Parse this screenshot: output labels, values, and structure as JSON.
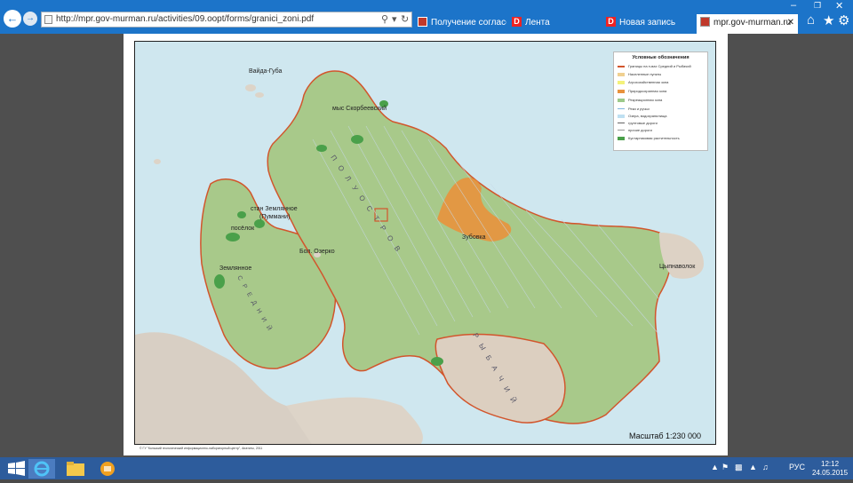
{
  "browser": {
    "url": "http://mpr.gov-murman.ru/activities/09.oopt/forms/granici_zoni.pdf",
    "tabs": [
      {
        "label": "Получение согласован..."
      },
      {
        "label": "Лента"
      },
      {
        "label": "Новая запись"
      },
      {
        "label": "mpr.gov-murman.ru"
      }
    ],
    "back_icon": "arrow-left-icon",
    "forward_icon": "arrow-right-icon",
    "home_icon": "home-icon",
    "star_icon": "star-icon",
    "settings_icon": "gear-icon",
    "accent": "#1c74c9"
  },
  "map": {
    "places": {
      "vaida_guba": "Вайда-Губа",
      "mys_skorbeevskiy": "мыс Скорбеевский",
      "stan_zemlyanoe": "стан Землянное",
      "pummanki": "(Пуммани)",
      "posyolok": "посёлок",
      "zemlyanoe": "Землянное",
      "bol_ozerko": "Бол. Озерко",
      "zubovka": "Зубовка",
      "tsypnavolok": "Цыпнаволок"
    },
    "peninsula_sredniy": "П О Л У О С Т Р О В",
    "peninsula_rybachiy": "Р Ы Б А Ч И Й",
    "peninsula_sredniy_small": "С Р Е Д Н И Й",
    "scale": "Масштаб 1:230 000",
    "copyright": "© ГУ \"Кольский геологический информационно-лабораторный центр\", Апатиты, 2011",
    "colors": {
      "sea": "#cfe7ef",
      "land": "#a8c98a",
      "reserve": "#e8923c",
      "border": "#d2552c",
      "mountains": "#d8cfc4"
    }
  },
  "legend": {
    "title": "Условные обозначения",
    "items": [
      {
        "label": "Границы на п-вах Средний и Рыбачий",
        "color": "#d2552c"
      },
      {
        "label": "Населенные пункты",
        "color": "#f0d090"
      },
      {
        "label": "Агрохозяйственная зона",
        "color": "#f4f27a"
      },
      {
        "label": "Природоохранная зона",
        "color": "#e8923c"
      },
      {
        "label": "Рекреационная зона",
        "color": "#9cc98a"
      },
      {
        "label": "Реки и ручьи",
        "color": "#7fb5e0"
      },
      {
        "label": "Озера, водохранилища",
        "color": "#bfe0f2"
      },
      {
        "label": "грунтовые дороги",
        "color": "#666666"
      },
      {
        "label": "прочие дороги",
        "color": "#999999"
      },
      {
        "label": "Кустарниковая растительность",
        "color": "#4aa04a"
      }
    ]
  },
  "taskbar": {
    "lang": "РУС",
    "time": "12:12",
    "date": "24.05.2015"
  }
}
